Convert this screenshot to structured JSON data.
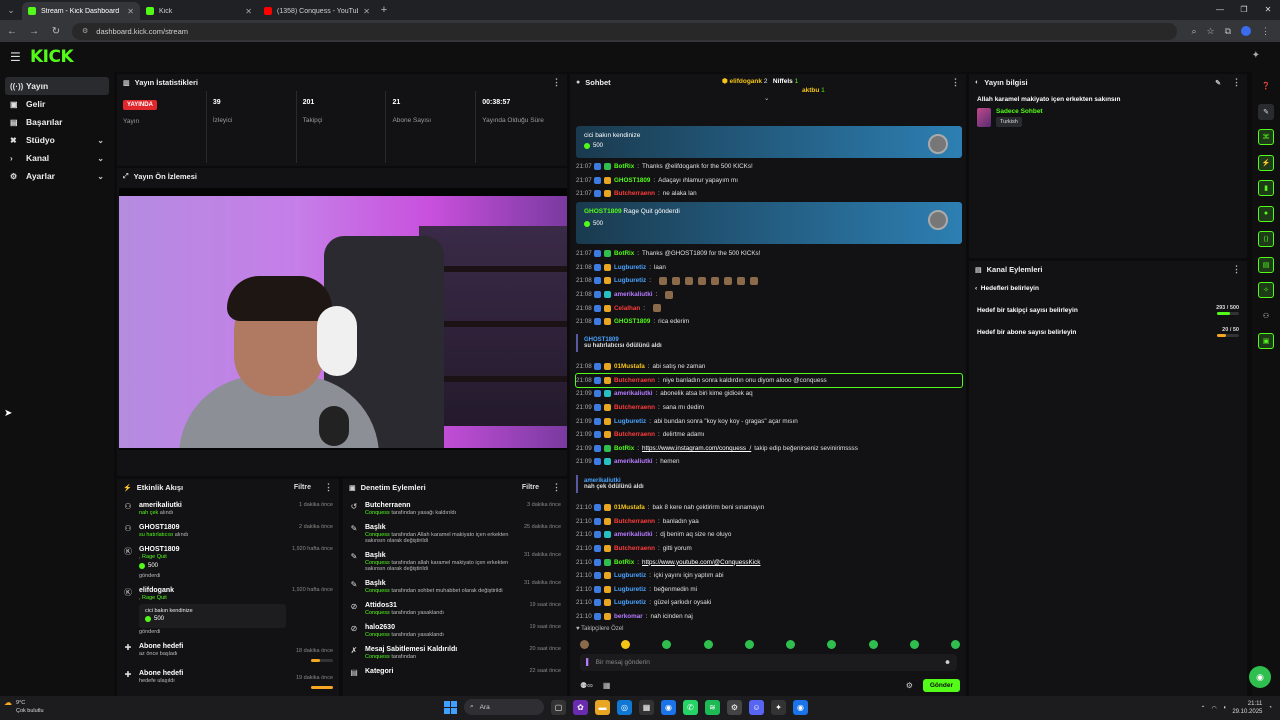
{
  "browser": {
    "tabs": [
      {
        "label": "Stream - Kick Dashboard",
        "icon": "kick-icon",
        "active": true
      },
      {
        "label": "Kick",
        "icon": "kick-icon",
        "active": false
      },
      {
        "label": "(1358) Conquess - YouTube",
        "icon": "youtube-icon",
        "active": false
      }
    ],
    "url": "dashboard.kick.com/stream"
  },
  "app": {
    "logo": "KICK"
  },
  "sidebar": {
    "items": [
      {
        "label": "Yayın",
        "icon": "broadcast-icon",
        "active": true,
        "expandable": false
      },
      {
        "label": "Gelir",
        "icon": "wallet-icon",
        "active": false,
        "expandable": false
      },
      {
        "label": "Başarılar",
        "icon": "trophy-icon",
        "active": false,
        "expandable": false
      },
      {
        "label": "Stüdyo",
        "icon": "studio-icon",
        "active": false,
        "expandable": true
      },
      {
        "label": "Kanal",
        "icon": "channel-icon",
        "active": false,
        "expandable": true
      },
      {
        "label": "Ayarlar",
        "icon": "gear-icon",
        "active": false,
        "expandable": true
      }
    ]
  },
  "stats_panel": {
    "title": "Yayın İstatistikleri",
    "live_badge": "YAYINDA",
    "stats": [
      {
        "value": "",
        "label": "Yayın"
      },
      {
        "value": "39",
        "label": "İzleyici"
      },
      {
        "value": "201",
        "label": "Takipçi"
      },
      {
        "value": "21",
        "label": "Abone Sayısı"
      },
      {
        "value": "00:38:57",
        "label": "Yayında Olduğu Süre"
      }
    ]
  },
  "preview_panel": {
    "title": "Yayın Ön İzlemesi"
  },
  "activity_panel": {
    "title": "Etkinlik Akışı",
    "filter": "Filtre",
    "items": [
      {
        "name": "amerikaliutki",
        "sub": "nah çek",
        "sub_muted": "alındı",
        "time": "1 dakika önce"
      },
      {
        "name": "GHOST1809",
        "sub": "su hatırlatıcısı",
        "sub_muted": "alındı",
        "time": "2 dakika önce"
      },
      {
        "name": "GHOST1809",
        "sub": ", Rage Quit",
        "kicks": "500",
        "sub_muted": "gönderdi",
        "time": "1,920 hafta önce"
      },
      {
        "name": "elifdogank",
        "sub": ", Rage Quit",
        "card": "cici bakın kendinize",
        "kicks": "500",
        "sub_muted": "gönderdi",
        "time": "1,920 hafta önce"
      },
      {
        "name": "Abone hedefi",
        "sub_muted": "az önce başladı",
        "time": "18 dakika önce",
        "progress": 0.4
      },
      {
        "name": "Abone hedefi",
        "sub_muted": "hedefe ulaşıldı",
        "time": "19 dakika önce",
        "progress": 1.0
      }
    ]
  },
  "moderation_panel": {
    "title": "Denetim Eylemleri",
    "filter": "Filtre",
    "items": [
      {
        "name": "Butcherraenn",
        "actor": "Conquess",
        "text": "tarafından yasağı kaldırıldı",
        "time": "3 dakika önce",
        "icon": "unban-icon"
      },
      {
        "name": "Başlık",
        "actor": "Conquess",
        "text": "tarafından Allah karamel makiyato içen erkekten sakınsın olarak değiştirildi",
        "time": "25 dakika önce",
        "icon": "title-icon"
      },
      {
        "name": "Başlık",
        "actor": "Conquess",
        "text": "tarafından allah karamel makiyato içen erkekten sakınsın olarak değiştirildi",
        "time": "31 dakika önce",
        "icon": "title-icon"
      },
      {
        "name": "Başlık",
        "actor": "Conquess",
        "text": "tarafından sohbet muhabbet olarak değiştirildi",
        "time": "31 dakika önce",
        "icon": "title-icon"
      },
      {
        "name": "Attidos31",
        "actor": "Conquess",
        "text": "tarafından yasaklandı",
        "time": "19 saat önce",
        "icon": "ban-icon"
      },
      {
        "name": "halo2630",
        "actor": "Conquess",
        "text": "tarafından yasaklandı",
        "time": "19 saat önce",
        "icon": "ban-icon"
      },
      {
        "name": "Mesaj Sabitlemesi Kaldırıldı",
        "actor": "Conquess",
        "text": "tarafından",
        "time": "20 saat önce",
        "icon": "unpin-icon"
      },
      {
        "name": "Kategori",
        "actor": "",
        "text": "",
        "time": "22 saat önce",
        "icon": "category-icon"
      }
    ]
  },
  "chat": {
    "title": "Sohbet",
    "top_users": [
      {
        "name": "elifdogank",
        "count": "2"
      },
      {
        "name": "Niffels",
        "count": "1"
      },
      {
        "name": "aktbu",
        "count": "1"
      }
    ],
    "pinned": [
      {
        "text": "cici bakın kendinize",
        "kicks": "500"
      },
      {
        "user": "GHOST1809",
        "text": "Rage Quit gönderdi",
        "kicks": "500"
      }
    ],
    "block1": [
      {
        "time": "21:07",
        "user": "BotRix",
        "color": "green",
        "text": "Thanks @elifdogank for the 500 KICKs!"
      },
      {
        "time": "21:07",
        "user": "GHOST1809",
        "color": "green",
        "text": "Adaçayı ıhlamur yapayım mı"
      },
      {
        "time": "21:07",
        "user": "Butcherraenn",
        "color": "red",
        "text": "ne alaka lan"
      }
    ],
    "block2": [
      {
        "time": "21:07",
        "user": "BotRix",
        "color": "green",
        "text": "Thanks @GHOST1809 for the 500 KICKs!"
      },
      {
        "time": "21:08",
        "user": "Lugburetiz",
        "color": "blue",
        "text": "laan"
      },
      {
        "time": "21:08",
        "user": "Lugburetiz",
        "color": "blue",
        "text": ""
      },
      {
        "time": "21:08",
        "user": "amerikaliutki",
        "color": "purple",
        "text": ""
      },
      {
        "time": "21:08",
        "user": "Celalhan",
        "color": "red",
        "text": ""
      },
      {
        "time": "21:08",
        "user": "GHOST1809",
        "color": "green",
        "text": "rica ederim"
      }
    ],
    "sys1": {
      "user": "GHOST1809",
      "text": "su hatırlatıcısı ödülünü aldı"
    },
    "block3": [
      {
        "time": "21:08",
        "user": "01Mustafa",
        "color": "yellow",
        "text": "abi satış ne zaman",
        "hl": false
      },
      {
        "time": "21:08",
        "user": "Butcherraenn",
        "color": "red",
        "text": "niye banladın sonra kaldırdın onu diyom alooo @conquess",
        "hl": true
      },
      {
        "time": "21:09",
        "user": "amerikaliutki",
        "color": "purple",
        "text": "abonelik atsa biri kime gidicek aq",
        "hl": false
      },
      {
        "time": "21:09",
        "user": "Butcherraenn",
        "color": "red",
        "text": "sana mı dedim",
        "hl": false
      },
      {
        "time": "21:09",
        "user": "Lugburetiz",
        "color": "blue",
        "text": "abi bundan sonra \"koy koy koy - gragas\" açar mısın",
        "hl": false
      },
      {
        "time": "21:09",
        "user": "Butcherraenn",
        "color": "red",
        "text": "delirtme adamı",
        "hl": false
      },
      {
        "time": "21:09",
        "user": "BotRix",
        "color": "green",
        "text": "https://www.instagram.com/conquess_/",
        "suffix": "takip edip beğenirseniz sevinirimssss",
        "hl": false
      },
      {
        "time": "21:09",
        "user": "amerikaliutki",
        "color": "purple",
        "text": "hemen",
        "hl": false
      }
    ],
    "sys2": {
      "user": "amerikaliutki",
      "text": "nah çek ödülünü aldı"
    },
    "block4": [
      {
        "time": "21:10",
        "user": "01Mustafa",
        "color": "yellow",
        "text": "bak 8 kere nah çektirirm beni sınamayın"
      },
      {
        "time": "21:10",
        "user": "Butcherraenn",
        "color": "red",
        "text": "banladın yaa"
      },
      {
        "time": "21:10",
        "user": "amerikaliutki",
        "color": "purple",
        "text": "dj benim aq size ne oluyo"
      },
      {
        "time": "21:10",
        "user": "Butcherraenn",
        "color": "red",
        "text": "gitti yorum"
      },
      {
        "time": "21:10",
        "user": "BotRix",
        "color": "green",
        "text": "https://www.youtube.com/@ConquessKick"
      },
      {
        "time": "21:10",
        "user": "Lugburetiz",
        "color": "blue",
        "text": "içki yayını için yaptım abi"
      },
      {
        "time": "21:10",
        "user": "Lugburetiz",
        "color": "blue",
        "text": "beğenmedin mi"
      },
      {
        "time": "21:10",
        "user": "Lugburetiz",
        "color": "blue",
        "text": "güzel şarkıdır oysaki"
      },
      {
        "time": "21:10",
        "user": "berkomar",
        "color": "plain",
        "text": "nah icinden naj"
      }
    ],
    "followers_only": "Takipçilere Özel",
    "input_placeholder": "Bir mesaj gönderin",
    "send": "Gönder"
  },
  "info_panel": {
    "title": "Yayın bilgisi",
    "stream_title": "Allah karamel makiyato içen erkekten sakınsın",
    "category": "Sadece Sohbet",
    "tag": "Turkish"
  },
  "actions_panel": {
    "title": "Kanal Eylemleri",
    "back_label": "Hedefleri belirleyin",
    "goals": [
      {
        "label": "Hedef bir takipçi sayısı belirleyin",
        "value": "293 / 500",
        "fraction": 0.586
      },
      {
        "label": "Hedef bir abone sayısı belirleyin",
        "value": "20 / 50",
        "fraction": 0.4
      }
    ]
  },
  "taskbar": {
    "weather_temp": "9°C",
    "weather_text": "Çok bulutlu",
    "search": "Ara",
    "time": "21:11",
    "date": "29.10.2025"
  }
}
